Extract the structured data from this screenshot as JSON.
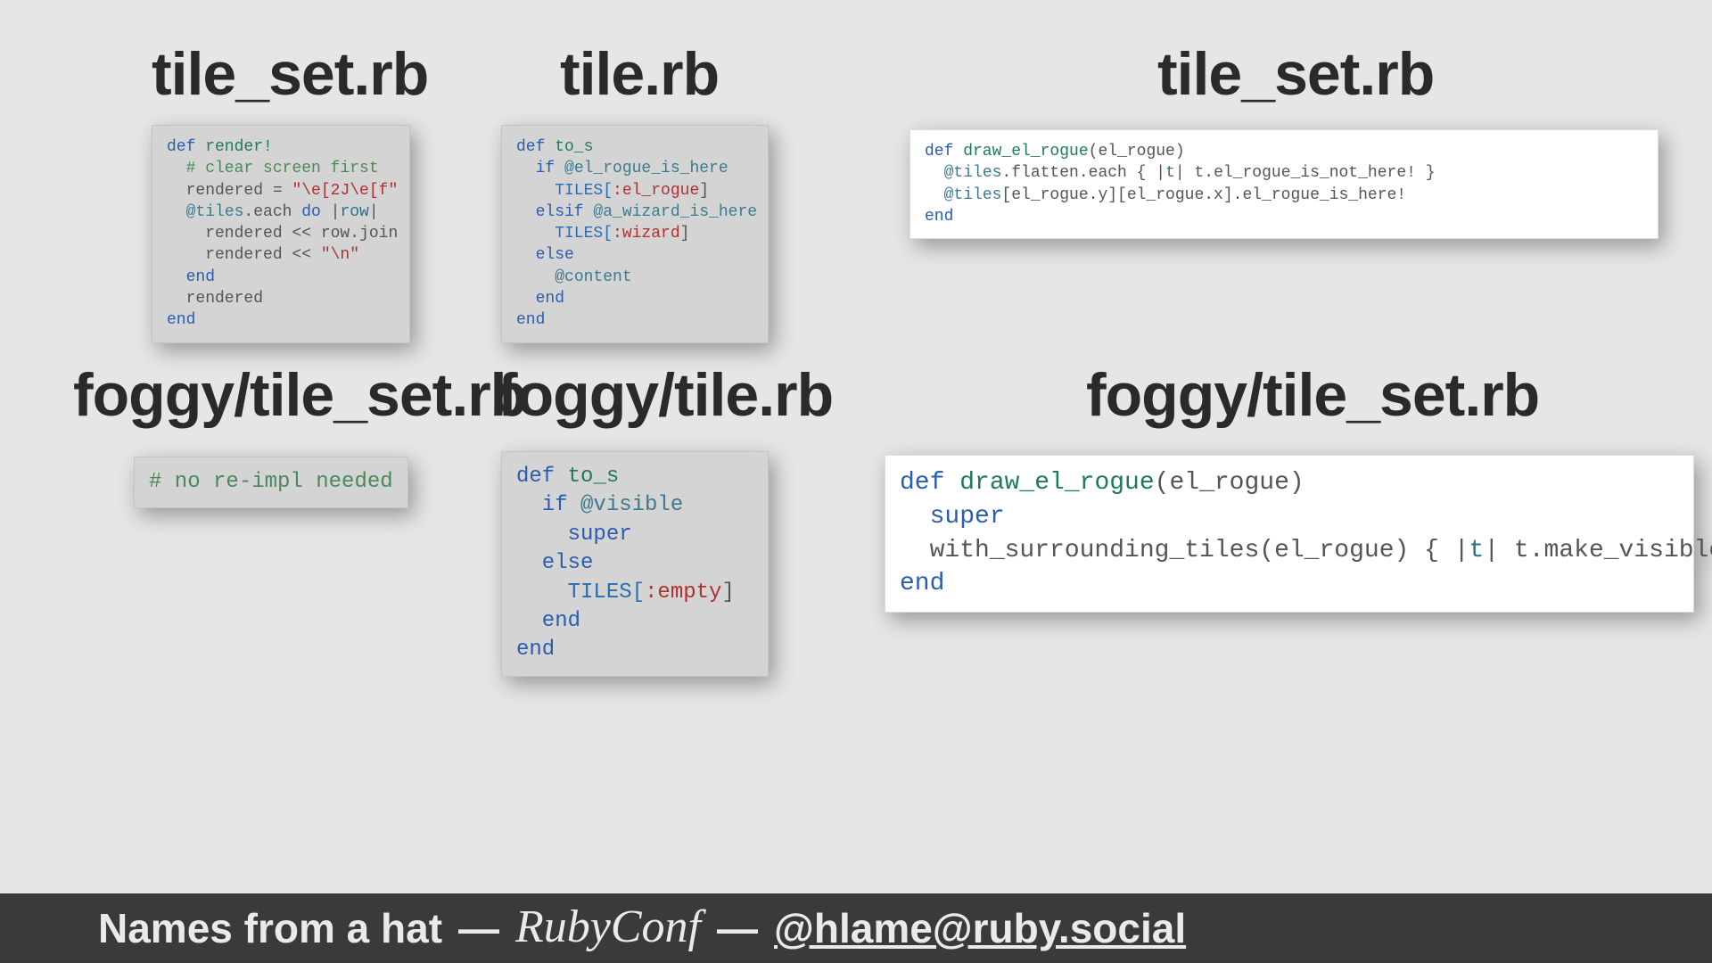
{
  "headings": {
    "tl": "tile_set.rb",
    "tm": "tile.rb",
    "tr": "tile_set.rb",
    "bl": "foggy/tile_set.rb",
    "bm": "foggy/tile.rb",
    "br": "foggy/tile_set.rb"
  },
  "code": {
    "render": {
      "l1a": "def",
      "l1b": " render!",
      "l2": "  # clear screen first",
      "l3a": "  rendered = ",
      "l3b": "\"\\e[2J\\e[f\"",
      "l4a": "  ",
      "l4ivar": "@tiles",
      "l4b": ".each ",
      "l4do": "do",
      "l4c": " |",
      "l4var": "row",
      "l4d": "|",
      "l5a": "    rendered << row.join",
      "l6a": "    rendered << ",
      "l6b": "\"\\n\"",
      "l7": "  end",
      "l8": "  rendered",
      "l9": "end"
    },
    "to_s_tile": {
      "l1a": "def",
      "l1b": " to_s",
      "l2a": "  if ",
      "l2b": "@el_rogue_is_here",
      "l3a": "    TILES[",
      "l3b": ":el_rogue",
      "l3c": "]",
      "l4a": "  elsif ",
      "l4b": "@a_wizard_is_here",
      "l5a": "    TILES[",
      "l5b": ":wizard",
      "l5c": "]",
      "l6": "  else",
      "l7a": "    ",
      "l7b": "@content",
      "l8": "  end",
      "l9": "end"
    },
    "draw_small": {
      "l1a": "def",
      "l1b": " draw_el_rogue",
      "l1c": "(el_rogue)",
      "l2a": "  ",
      "l2ivar": "@tiles",
      "l2b": ".flatten.each { |",
      "l2var": "t",
      "l2c": "| t.el_rogue_is_not_here! }",
      "l3a": "  ",
      "l3ivar": "@tiles",
      "l3b": "[el_rogue.y][el_rogue.x].el_rogue_is_here!",
      "l4": "end"
    },
    "noreimpl": "# no re-impl needed",
    "to_s_foggy": {
      "l1a": "def",
      "l1b": " to_s",
      "l2a": "  if ",
      "l2b": "@visible",
      "l3": "    super",
      "l4": "  else",
      "l5a": "    TILES[",
      "l5b": ":empty",
      "l5c": "]",
      "l6": "  end",
      "l7": "end"
    },
    "draw_big": {
      "l1a": "def",
      "l1b": " draw_el_rogue",
      "l1c": "(el_rogue)",
      "l2": "  super",
      "l3a": "  with_surrounding_tiles(el_rogue) { |",
      "l3var": "t",
      "l3b": "| t.make_visible! }",
      "l4": "end"
    }
  },
  "footer": {
    "left": "Names from a hat",
    "dash": "—",
    "conf": "RubyConf",
    "handle": "@hlame@ruby.social"
  }
}
